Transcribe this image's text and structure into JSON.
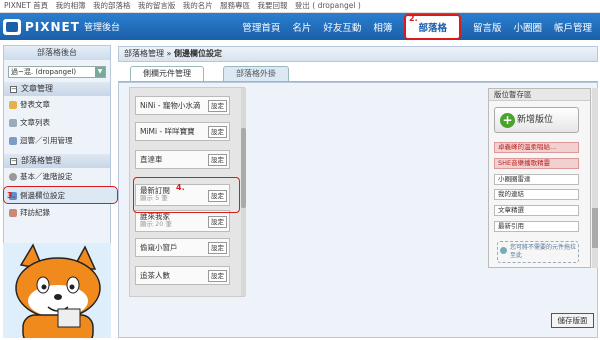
{
  "topbar": {
    "items": [
      "PIXNET 首頁",
      "我的相簿",
      "我的部落格",
      "我的留言版",
      "我的名片",
      "服務專區",
      "我要回報",
      "登出 ( dropangel )"
    ]
  },
  "header": {
    "logo_text": "PIXNET",
    "logo_sub": "管理後台",
    "nav": [
      "管理首頁",
      "名片",
      "好友互動",
      "相簿",
      "部落格",
      "留言版",
      "小圈圈",
      "帳戶管理"
    ],
    "active_nav": "部落格"
  },
  "annotations": {
    "a2": "2.",
    "a3": "3.",
    "a4": "4."
  },
  "sidebar": {
    "title": "部落格後台",
    "blog_select": "過~混. (dropangel)",
    "sections": [
      {
        "label": "文章管理",
        "items": [
          "發表文章",
          "文章列表",
          "迴響／引用管理"
        ]
      },
      {
        "label": "部落格管理",
        "items": [
          "基本／進階設定",
          "側邊欄位設定",
          "拜訪紀錄"
        ]
      }
    ],
    "selected_item": "側邊欄位設定"
  },
  "breadcrumb": {
    "root": "部落格管理",
    "sep": "»",
    "current": "側邊欄位設定"
  },
  "tabs": [
    "側欄元件管理",
    "部落格外掛"
  ],
  "widgets": [
    {
      "name": "NiNi - 寵物小水滴",
      "sub": "",
      "button": "設定"
    },
    {
      "name": "MiMi - 咩咩寶寶",
      "sub": "",
      "button": "設定"
    },
    {
      "name": "直達車",
      "sub": "",
      "button": "設定"
    },
    {
      "name": "最新訂閱",
      "sub": "顯示 5 筆",
      "button": "設定"
    },
    {
      "name": "誰來我家",
      "sub": "顯示 20 筆",
      "button": "設定"
    },
    {
      "name": "偷窺小窗戶",
      "sub": "",
      "button": "設定"
    },
    {
      "name": "追茶人數",
      "sub": "",
      "button": "設定"
    }
  ],
  "right_panel": {
    "title": "版位暫存區",
    "new_button": "新增版位",
    "items": [
      {
        "label": "卓義峰的溫柔唱給...",
        "style": "red"
      },
      {
        "label": "SHE音樂播歌精靈",
        "style": "red"
      },
      {
        "label": "小圈圈雷達",
        "style": "normal"
      },
      {
        "label": "我的連結",
        "style": "normal"
      },
      {
        "label": "文章精選",
        "style": "normal"
      },
      {
        "label": "最新引用",
        "style": "normal"
      }
    ],
    "hint": "您可將不需要的元件拖拉至此"
  },
  "save_button": "儲存版面",
  "colors": {
    "header_blue": "#1b5fa8",
    "annotation_red": "#d81b1b",
    "plus_green": "#4aa32a"
  }
}
